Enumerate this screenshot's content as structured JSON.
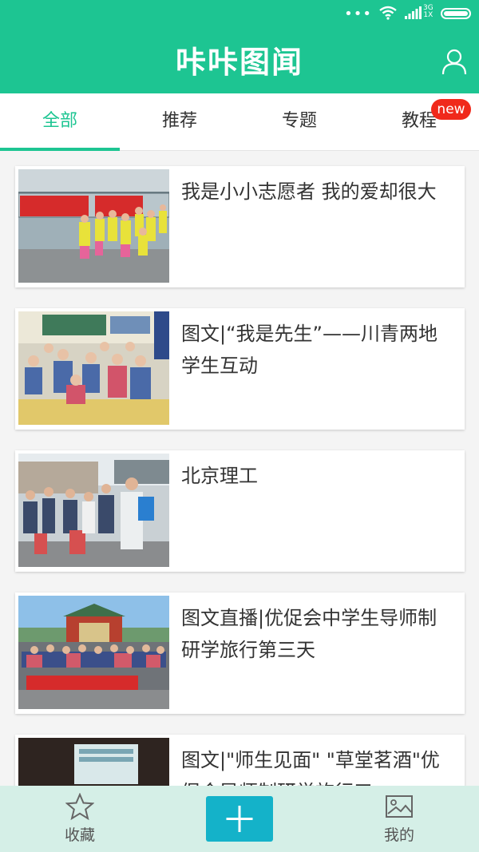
{
  "statusbar": {
    "network_top": "3G",
    "network_bottom": "1X",
    "icons": [
      "more-dots-icon",
      "wifi-icon",
      "signal-icon",
      "battery-icon"
    ]
  },
  "header": {
    "title": "咔咔图闻",
    "right_icon": "user-icon"
  },
  "tabs": [
    {
      "label": "全部",
      "active": true
    },
    {
      "label": "推荐",
      "active": false
    },
    {
      "label": "专题",
      "active": false
    },
    {
      "label": "教程",
      "active": false,
      "badge": "new"
    }
  ],
  "articles": [
    {
      "title": "我是小小志愿者 我的爱却很大"
    },
    {
      "title": "图文|“我是先生”——川青两地学生互动"
    },
    {
      "title": "北京理工"
    },
    {
      "title": "图文直播|优促会中学生导师制研学旅行第三天"
    },
    {
      "title": "图文|\"师生见面\" \"草堂茗酒\"优促会导师制研学旅行五"
    }
  ],
  "bottom_nav": {
    "favorites_label": "收藏",
    "mine_label": "我的",
    "add_icon": "plus-icon"
  },
  "colors": {
    "brand": "#1dc592",
    "accent_button": "#14b2c9",
    "badge": "#f0291b",
    "bottom_bar": "#d5efe7"
  }
}
